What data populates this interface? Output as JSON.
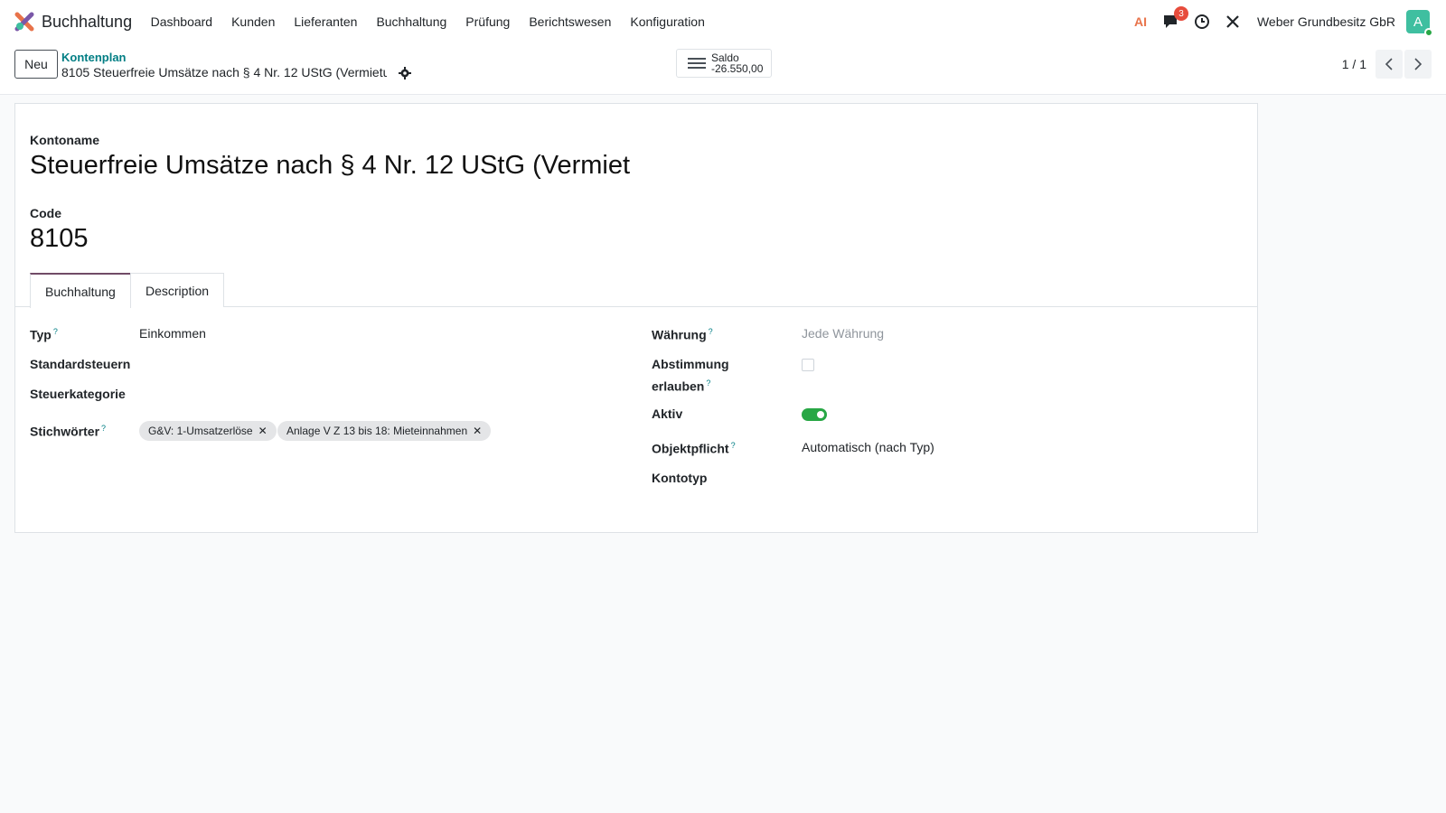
{
  "navbar": {
    "app_name": "Buchhaltung",
    "menu": [
      {
        "label": "Dashboard"
      },
      {
        "label": "Kunden"
      },
      {
        "label": "Lieferanten"
      },
      {
        "label": "Buchhaltung"
      },
      {
        "label": "Prüfung"
      },
      {
        "label": "Berichtswesen"
      },
      {
        "label": "Konfiguration"
      }
    ],
    "ai_label": "AI",
    "messages_badge": "3",
    "company": "Weber Grundbesitz GbR",
    "avatar_letter": "A"
  },
  "control": {
    "new_label": "Neu",
    "breadcrumb": "Kontenplan",
    "record_title": "8105 Steuerfreie Umsätze nach § 4 Nr. 12 UStG (Vermietu...",
    "stat_label": "Saldo",
    "stat_value": "-26.550,00",
    "pager": "1 / 1"
  },
  "sheet": {
    "name_label": "Kontoname",
    "name_value": "Steuerfreie Umsätze nach § 4 Nr. 12 UStG (Vermiet",
    "code_label": "Code",
    "code_value": "8105",
    "tabs": [
      {
        "label": "Buchhaltung",
        "active": true
      },
      {
        "label": "Description",
        "active": false
      }
    ],
    "left": {
      "typ_label": "Typ",
      "typ_value": "Einkommen",
      "standardsteuern_label": "Standardsteuern",
      "steuerkategorie_label": "Steuerkategorie",
      "stichwoerter_label": "Stichwörter",
      "tags": [
        "G&V: 1-Umsatzerlöse",
        "Anlage V Z 13 bis 18: Mieteinnahmen"
      ]
    },
    "right": {
      "waehrung_label": "Währung",
      "waehrung_placeholder": "Jede Währung",
      "abstimmung_label_1": "Abstimmung",
      "abstimmung_label_2": "erlauben",
      "aktiv_label": "Aktiv",
      "objektpflicht_label": "Objektpflicht",
      "objektpflicht_value": "Automatisch (nach Typ)",
      "kontotyp_label": "Kontotyp"
    },
    "help_mark": "?"
  },
  "colors": {
    "brand": "#714b67",
    "link": "#017e84",
    "toggle_on": "#28a745",
    "badge": "#e74c3c"
  }
}
